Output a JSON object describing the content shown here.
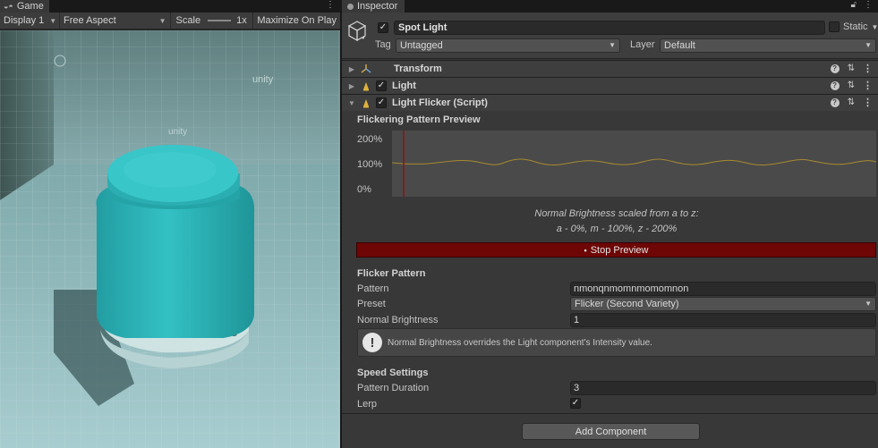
{
  "game": {
    "tab_label": "Game",
    "display": "Display 1",
    "aspect": "Free Aspect",
    "scale_label": "Scale",
    "scale_value": "1x",
    "maximize": "Maximize On Play"
  },
  "inspector": {
    "tab_label": "Inspector",
    "object_name": "Spot Light",
    "object_active": true,
    "static_label": "Static",
    "tag_label": "Tag",
    "tag_value": "Untagged",
    "layer_label": "Layer",
    "layer_value": "Default",
    "components": [
      {
        "title": "Transform",
        "expanded": false,
        "has_checkbox": false
      },
      {
        "title": "Light",
        "expanded": false,
        "has_checkbox": true
      },
      {
        "title": "Light Flicker (Script)",
        "expanded": true,
        "has_checkbox": true
      }
    ],
    "preview": {
      "title": "Flickering Pattern Preview",
      "y_labels": [
        "200%",
        "100%",
        "0%"
      ],
      "caption_line1": "Normal Brightness scaled from a to z:",
      "caption_line2": "a - 0%, m - 100%, z - 200%",
      "stop_label": "Stop Preview"
    },
    "flicker_pattern": {
      "section": "Flicker Pattern",
      "pattern_label": "Pattern",
      "pattern_value": "nmonqnmomnmomomnon",
      "preset_label": "Preset",
      "preset_value": "Flicker (Second Variety)",
      "brightness_label": "Normal Brightness",
      "brightness_value": "1",
      "help_message": "Normal Brightness overrides the Light component's Intensity value."
    },
    "speed": {
      "section": "Speed Settings",
      "duration_label": "Pattern Duration",
      "duration_value": "3",
      "lerp_label": "Lerp",
      "lerp_checked": true
    },
    "add_component": "Add Component"
  },
  "colors": {
    "accent_red": "#6e0606",
    "waveform": "#a88a2e",
    "playhead": "#8a1414",
    "teal_object": "#2fb5b8"
  }
}
